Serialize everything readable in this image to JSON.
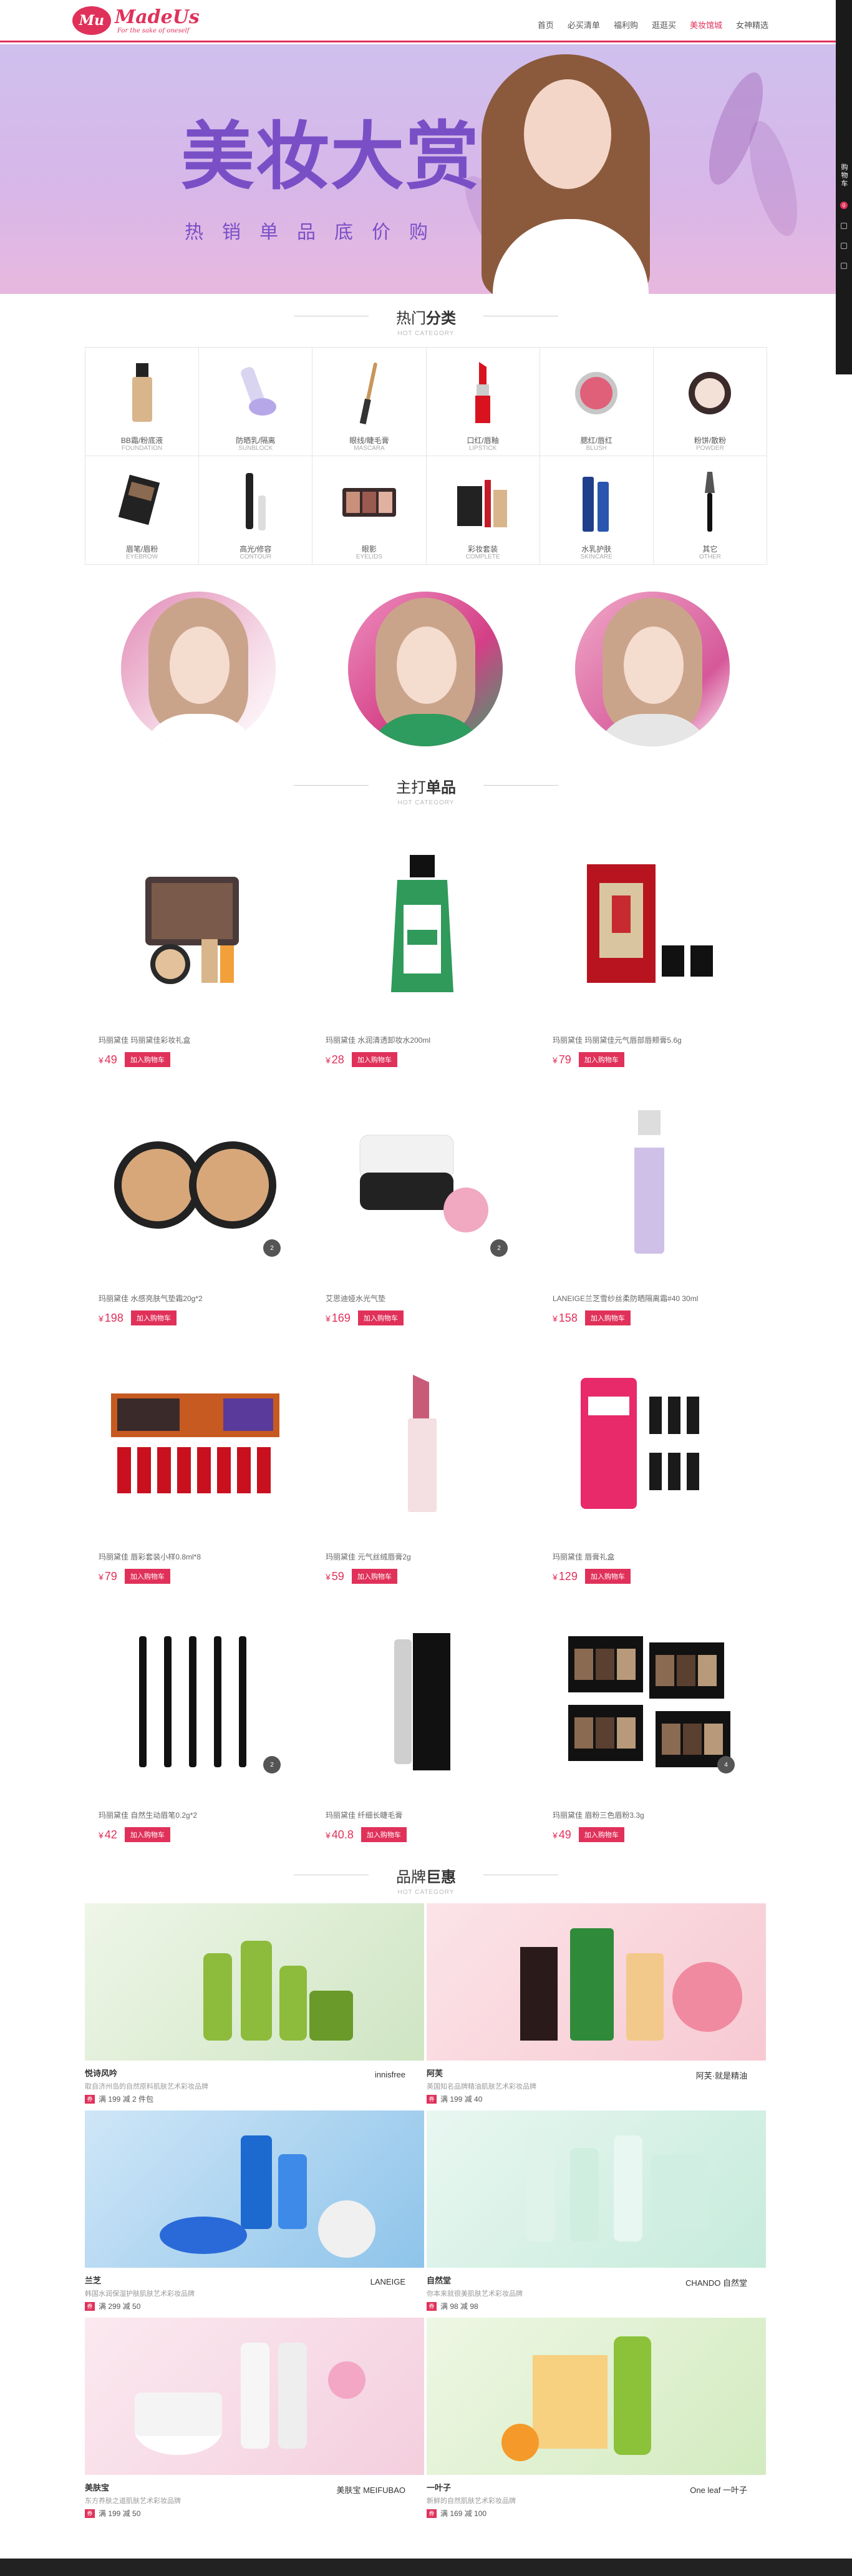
{
  "header": {
    "logo_badge": "Mu",
    "logo_name": "MadeUs",
    "logo_tagline": "For the sake of oneself",
    "nav": [
      "首页",
      "必买清单",
      "福利购",
      "逛逛买",
      "美妆馆城",
      "女神精选"
    ],
    "nav_active": 4
  },
  "sidebar": {
    "label": "购物车",
    "count": "0"
  },
  "banner": {
    "title": "美妆大赏",
    "subtitle": "热销单品底价购"
  },
  "hot_categories": {
    "title_plain": "热门",
    "title_bold": "分类",
    "subtitle": "HOT CATEGORY",
    "items": [
      {
        "name": "BB霜/粉底液",
        "en": "FOUNDATION",
        "icon": "foundation-bottle-icon"
      },
      {
        "name": "防晒乳/隔离",
        "en": "SUNBLOCK",
        "icon": "sunblock-tube-icon"
      },
      {
        "name": "眼线/睫毛膏",
        "en": "MASCARA",
        "icon": "mascara-wand-icon"
      },
      {
        "name": "口红/唇釉",
        "en": "LIPSTICK",
        "icon": "lipstick-icon"
      },
      {
        "name": "腮红/唇红",
        "en": "BLUSH",
        "icon": "blush-compact-icon"
      },
      {
        "name": "粉饼/散粉",
        "en": "POWDER",
        "icon": "powder-compact-icon"
      },
      {
        "name": "眉笔/眉粉",
        "en": "EYEBROW",
        "icon": "eyebrow-kit-icon"
      },
      {
        "name": "高光/修容",
        "en": "CONTOUR",
        "icon": "contour-stick-icon"
      },
      {
        "name": "眼影",
        "en": "EYELIDS",
        "icon": "eyeshadow-palette-icon"
      },
      {
        "name": "彩妆套装",
        "en": "COMPLETE",
        "icon": "makeup-set-icon"
      },
      {
        "name": "水乳护肤",
        "en": "SKINCARE",
        "icon": "skincare-bottle-icon"
      },
      {
        "name": "其它",
        "en": "OTHER",
        "icon": "brush-icon"
      }
    ]
  },
  "main_products": {
    "title_plain": "主打",
    "title_bold": "单品",
    "subtitle": "HOT CATEGORY",
    "cart_label": "加入购物车",
    "currency": "¥",
    "items": [
      {
        "name": "玛丽黛佳 玛丽黛佳彩妆礼盒",
        "price": "49",
        "image": "makeup-gift-box"
      },
      {
        "name": "玛丽黛佳 水润清透卸妆水200ml",
        "price": "28",
        "image": "cleansing-water-bottle"
      },
      {
        "name": "玛丽黛佳 玛丽黛佳元气唇部唇颊膏5.6g",
        "price": "79",
        "image": "lip-cheek-stick"
      },
      {
        "name": "玛丽黛佳 水感亮肤气垫霜20g*2",
        "price": "198",
        "image": "cushion-compacts",
        "badge": "2"
      },
      {
        "name": "艾思迪娅水光气垫",
        "price": "169",
        "image": "cushion-with-puff",
        "badge": "2"
      },
      {
        "name": "LANEIGE兰芝雪纱丝柔防晒隔离霜#40 30ml",
        "price": "158",
        "image": "primer-tube"
      },
      {
        "name": "玛丽黛佳 唇彩套装小样0.8ml*8",
        "price": "79",
        "image": "lipgloss-set"
      },
      {
        "name": "玛丽黛佳 元气丝绒唇膏2g",
        "price": "59",
        "image": "single-lipstick"
      },
      {
        "name": "玛丽黛佳 唇膏礼盒",
        "price": "129",
        "image": "lipstick-gift-box"
      },
      {
        "name": "玛丽黛佳 自然生动眉笔0.2g*2",
        "price": "42",
        "image": "eyebrow-pencils",
        "badge": "2"
      },
      {
        "name": "玛丽黛佳 纤细长睫毛膏",
        "price": "40.8",
        "image": "mascara-box"
      },
      {
        "name": "玛丽黛佳 眉粉三色眉粉3.3g",
        "price": "49",
        "image": "brow-powder-palettes",
        "badge": "4"
      }
    ]
  },
  "brand_deals": {
    "title_plain": "品牌",
    "title_bold": "巨惠",
    "subtitle": "HOT CATEGORY",
    "items": [
      {
        "name": "悦诗风吟",
        "desc": "取自济州岛的自然原料肌肤艺术彩妆品牌",
        "offer": "满 199 减 2 件包",
        "logo": "innisfree",
        "theme": "green"
      },
      {
        "name": "阿芙",
        "desc": "英国知名品牌精油肌肤艺术彩妆品牌",
        "offer": "满 199 减 40",
        "logo": "阿芙·就是精油",
        "theme": "pink"
      },
      {
        "name": "兰芝",
        "desc": "韩国水润保湿护肤肌肤艺术彩妆品牌",
        "offer": "满 299 减 50",
        "logo": "LANEIGE",
        "theme": "blue"
      },
      {
        "name": "自然堂",
        "desc": "你本来就很美肌肤艺术彩妆品牌",
        "offer": "满 98 减 98",
        "logo": "CHANDO 自然堂",
        "theme": "mint"
      },
      {
        "name": "美肤宝",
        "desc": "东方养肤之道肌肤艺术彩妆品牌",
        "offer": "满 199 减 50",
        "logo": "美肤宝 MEIFUBAO",
        "theme": "rose"
      },
      {
        "name": "一叶子",
        "desc": "新鲜的自然肌肤艺术彩妆品牌",
        "offer": "满 169 减 100",
        "logo": "One leaf 一叶子",
        "theme": "leaf"
      }
    ]
  },
  "colors": {
    "accent": "#e0315a",
    "banner_purple": "#7a4fc6"
  }
}
